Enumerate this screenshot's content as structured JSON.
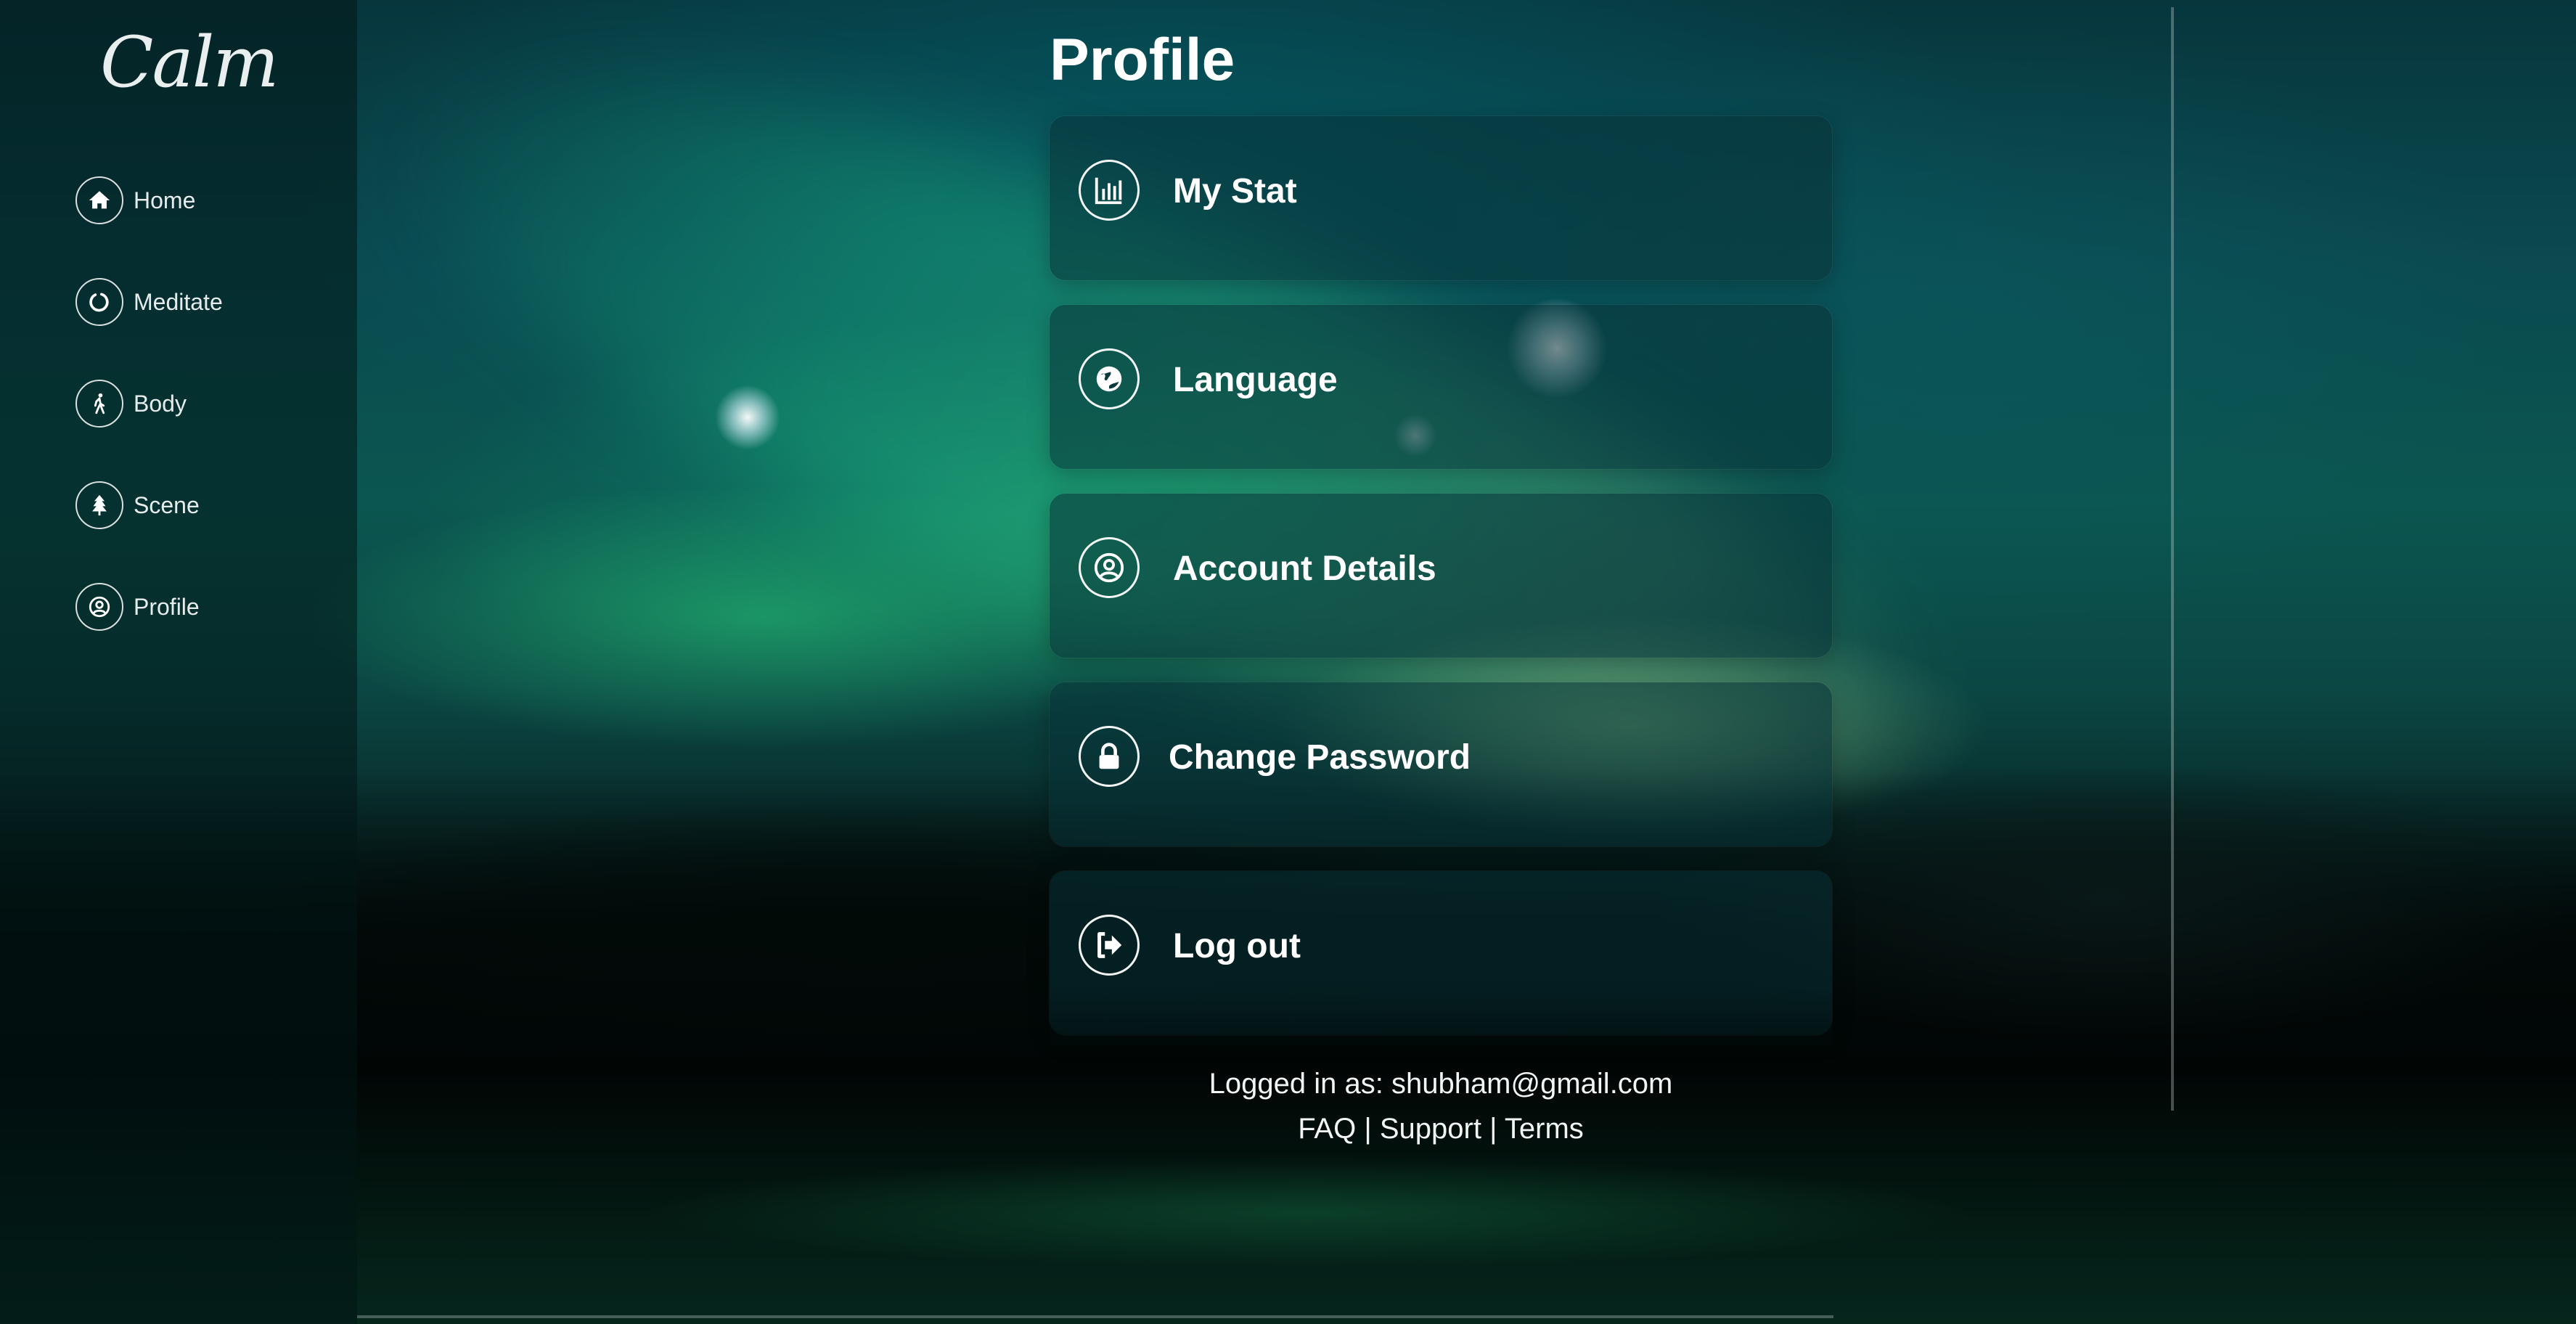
{
  "app": {
    "logo_text": "Calm"
  },
  "sidebar": {
    "items": [
      {
        "label": "Home",
        "icon": "home-icon"
      },
      {
        "label": "Meditate",
        "icon": "circle-icon"
      },
      {
        "label": "Body",
        "icon": "walking-icon"
      },
      {
        "label": "Scene",
        "icon": "tree-icon"
      },
      {
        "label": "Profile",
        "icon": "user-circle-icon"
      }
    ]
  },
  "main": {
    "title": "Profile",
    "cards": [
      {
        "label": "My Stat",
        "icon": "bar-chart-icon"
      },
      {
        "label": "Language",
        "icon": "globe-icon"
      },
      {
        "label": "Account Details",
        "icon": "user-circle-icon"
      },
      {
        "label": "Change Password",
        "icon": "lock-icon"
      },
      {
        "label": "Log out",
        "icon": "logout-icon"
      }
    ]
  },
  "footer": {
    "logged_in_prefix": "Logged in as:",
    "email": "shubham@gmail.com",
    "links": [
      "FAQ",
      "Support",
      "Terms"
    ],
    "separator": "|"
  },
  "colors": {
    "text": "#ffffff",
    "sidebar_bg": "#021616",
    "card_bg": "#083237"
  }
}
